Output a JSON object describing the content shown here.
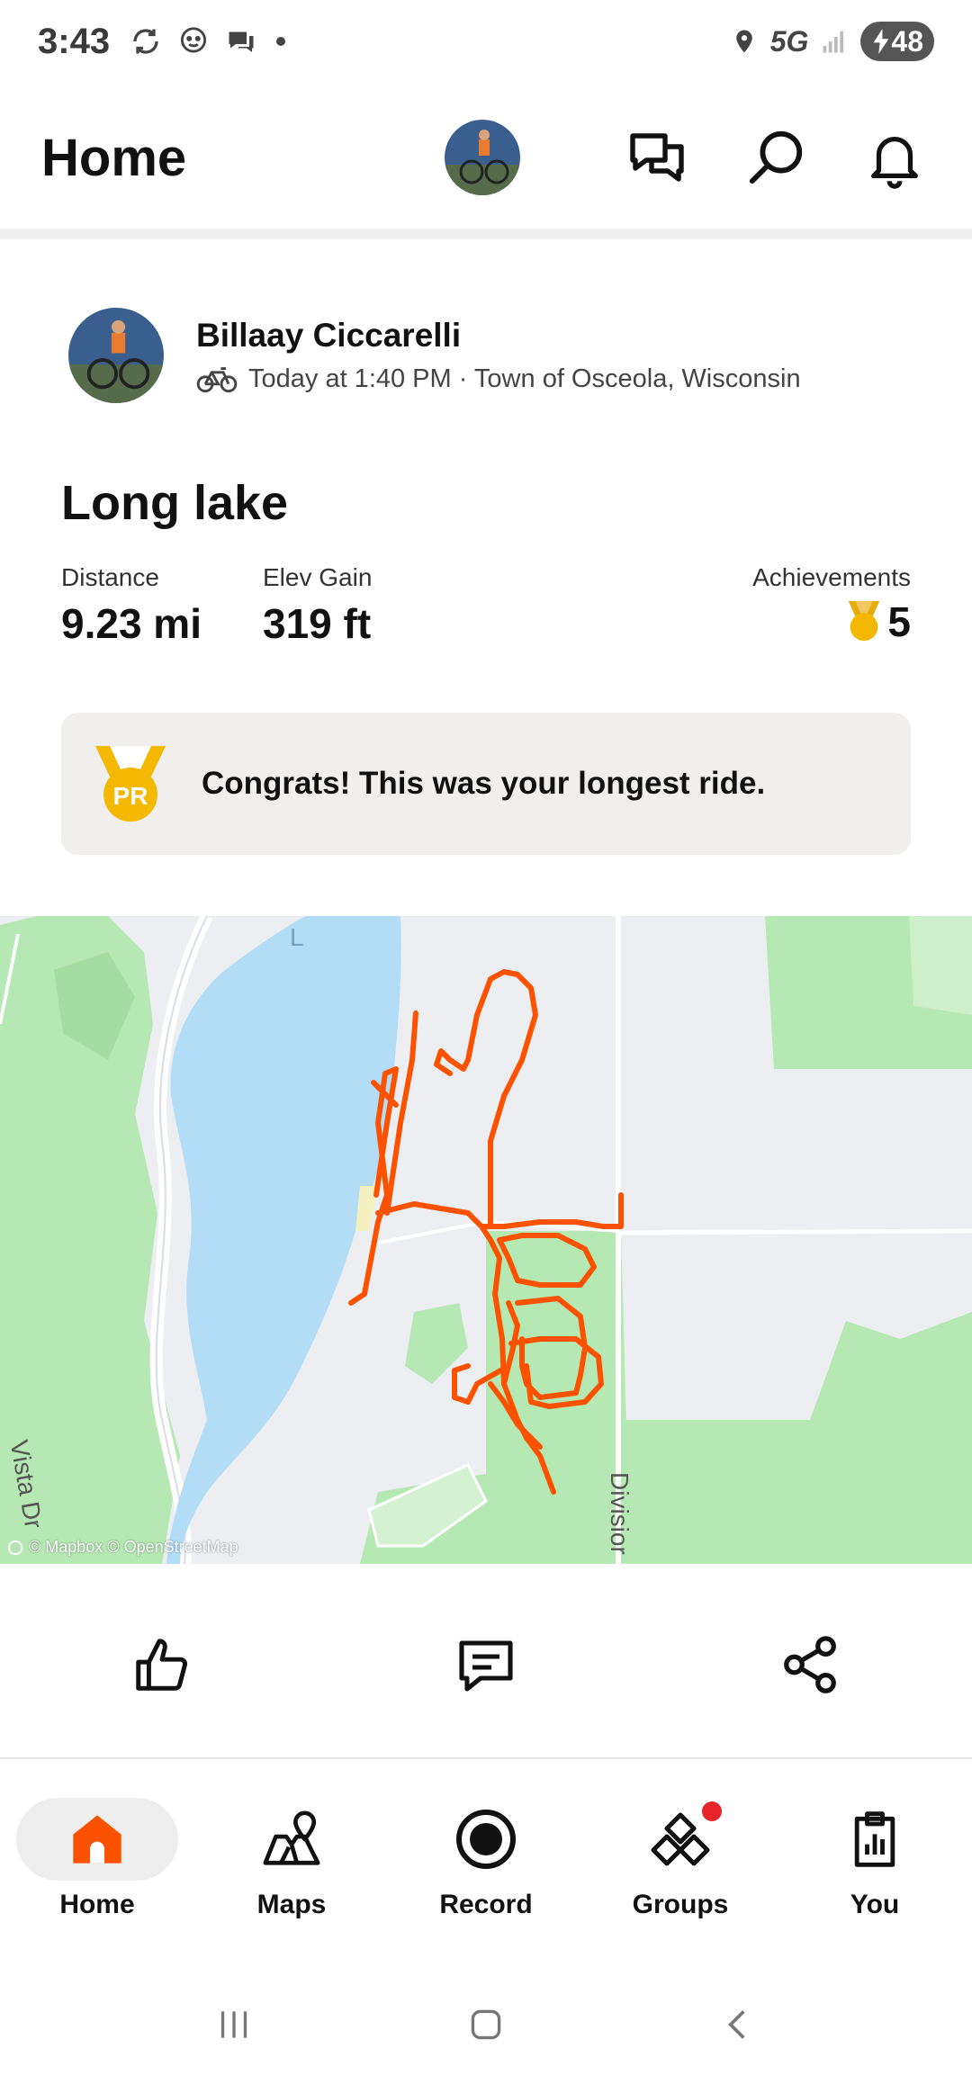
{
  "status_bar": {
    "time": "3:43",
    "network": "5G",
    "battery": "48",
    "icons": [
      "sync-icon",
      "waze-icon",
      "messages-icon",
      "dot-icon",
      "location-icon",
      "signal-icon",
      "battery-charging-icon"
    ]
  },
  "header": {
    "title": "Home",
    "actions": [
      "profile-avatar",
      "chat-icon",
      "search-icon",
      "bell-icon"
    ]
  },
  "activity": {
    "athlete_name": "Billaay Ciccarelli",
    "meta": "Today at 1:40 PM · Town of Osceola, Wisconsin",
    "sport_icon": "bike-icon",
    "title": "Long lake",
    "stats": {
      "distance_label": "Distance",
      "distance_value": "9.23 mi",
      "elev_label": "Elev Gain",
      "elev_value": "319 ft",
      "achievements_label": "Achievements",
      "achievements_value": "5"
    },
    "pr_banner": {
      "badge": "PR",
      "text": "Congrats! This was your longest ride."
    }
  },
  "map": {
    "attribution": "© Mapbox © OpenStreetMap",
    "road_labels": {
      "left": "Vista Dr",
      "right": "Divisior",
      "lake_top": "L"
    },
    "route_color": "#fc5200",
    "water_color": "#b3dcf7",
    "park_color": "#b6e8b3"
  },
  "action_row": [
    "kudos-icon",
    "comment-icon",
    "share-icon"
  ],
  "bottom_nav": {
    "items": [
      {
        "label": "Home",
        "active": true
      },
      {
        "label": "Maps",
        "active": false
      },
      {
        "label": "Record",
        "active": false
      },
      {
        "label": "Groups",
        "active": false,
        "badge": true
      },
      {
        "label": "You",
        "active": false
      }
    ],
    "accent": "#fc5200"
  },
  "system_nav": [
    "recents-icon",
    "home-icon",
    "back-icon"
  ]
}
